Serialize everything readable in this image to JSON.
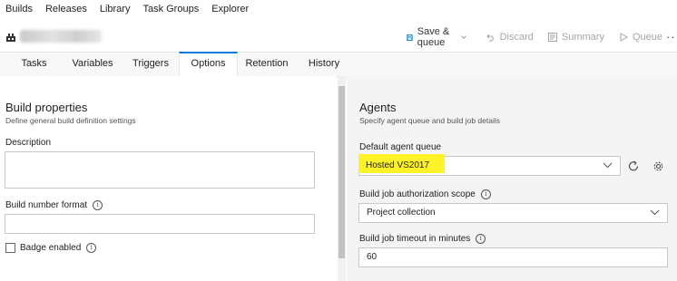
{
  "topnav": {
    "items": [
      "Builds",
      "Releases",
      "Library",
      "Task Groups",
      "Explorer"
    ]
  },
  "toolbar": {
    "save_queue": "Save & queue",
    "discard": "Discard",
    "summary": "Summary",
    "queue": "Queue",
    "more": "···"
  },
  "tabs": [
    "Tasks",
    "Variables",
    "Triggers",
    "Options",
    "Retention",
    "History"
  ],
  "active_tab": "Options",
  "build_properties": {
    "title": "Build properties",
    "subtitle": "Define general build definition settings",
    "description_label": "Description",
    "description_value": "",
    "build_number_label": "Build number format",
    "build_number_value": "",
    "badge_label": "Badge enabled",
    "badge_checked": false
  },
  "agents": {
    "title": "Agents",
    "subtitle": "Specify agent queue and build job details",
    "queue_label": "Default agent queue",
    "queue_value": "Hosted VS2017",
    "auth_label": "Build job authorization scope",
    "auth_value": "Project collection",
    "timeout_label": "Build job timeout in minutes",
    "timeout_value": "60"
  },
  "colors": {
    "accent": "#0078d7",
    "highlight": "#fff229",
    "right_pane_bg": "#f4f4f4"
  },
  "icons": [
    "build-definition-icon",
    "save-icon",
    "chevron-down-icon",
    "discard-icon",
    "summary-icon",
    "queue-play-icon",
    "refresh-icon",
    "gear-icon",
    "info-icon"
  ]
}
